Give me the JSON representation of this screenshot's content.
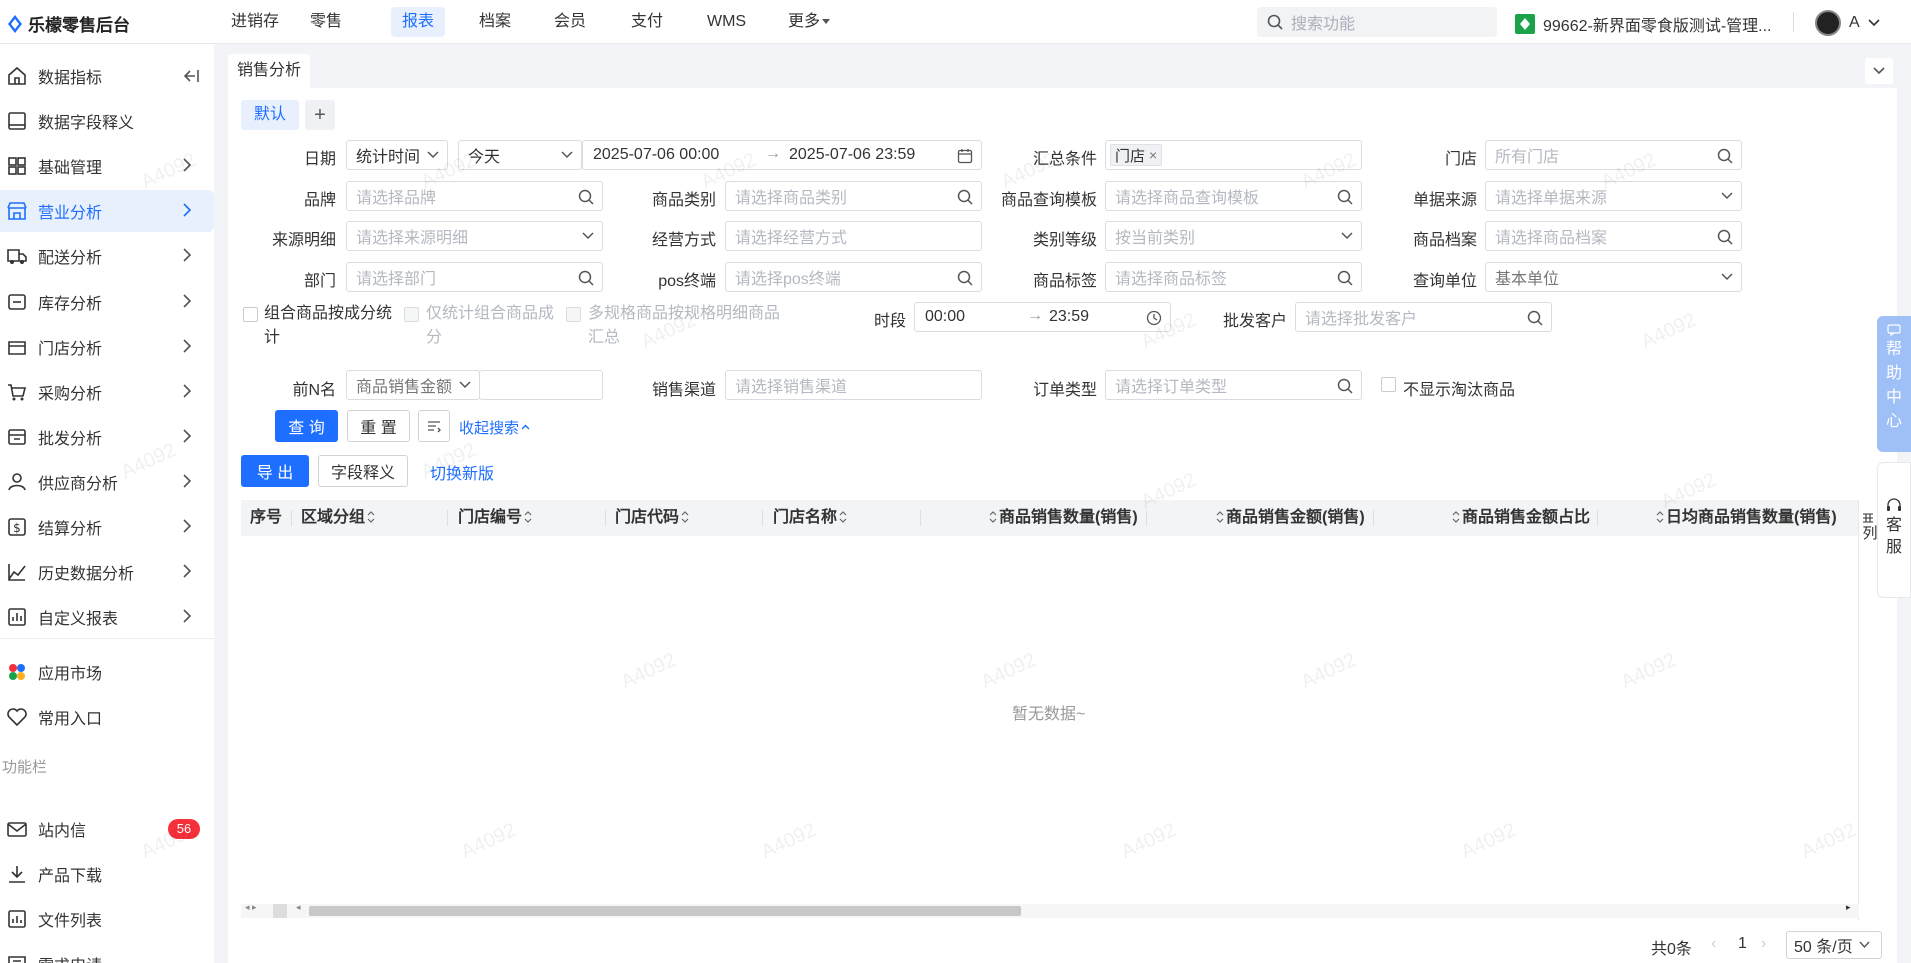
{
  "brand": {
    "name": "乐檬零售后台",
    "color": "#1e6fff"
  },
  "topnav": {
    "items": [
      "进销存",
      "零售",
      "报表",
      "档案",
      "会员",
      "支付",
      "WMS",
      "更多"
    ],
    "active_index": 2
  },
  "search": {
    "placeholder": "搜索功能"
  },
  "store": {
    "label": "99662-新界面零食版测试-管理..."
  },
  "user": {
    "name": "A"
  },
  "sidebar": {
    "collapse_icon": "collapse-icon",
    "items": [
      {
        "label": "数据指标",
        "icon": "home-icon"
      },
      {
        "label": "数据字段释义",
        "icon": "book-icon"
      },
      {
        "label": "基础管理",
        "icon": "grid-icon"
      },
      {
        "label": "营业分析",
        "icon": "store-icon"
      },
      {
        "label": "配送分析",
        "icon": "truck-icon"
      },
      {
        "label": "库存分析",
        "icon": "inventory-icon"
      },
      {
        "label": "门店分析",
        "icon": "shop-icon"
      },
      {
        "label": "采购分析",
        "icon": "cart-icon"
      },
      {
        "label": "批发分析",
        "icon": "wholesale-icon"
      },
      {
        "label": "供应商分析",
        "icon": "user-icon"
      },
      {
        "label": "结算分析",
        "icon": "dollar-icon"
      },
      {
        "label": "历史数据分析",
        "icon": "trend-icon"
      },
      {
        "label": "自定义报表",
        "icon": "report-icon"
      }
    ],
    "active_index": 3,
    "extra": [
      {
        "label": "应用市场",
        "icon": "apps-icon"
      },
      {
        "label": "常用入口",
        "icon": "heart-icon"
      }
    ],
    "section_label": "功能栏",
    "tools": [
      {
        "label": "站内信",
        "icon": "mail-icon",
        "badge": "56"
      },
      {
        "label": "产品下载",
        "icon": "download-icon"
      },
      {
        "label": "文件列表",
        "icon": "file-icon"
      },
      {
        "label": "需求申请",
        "icon": "request-icon"
      }
    ]
  },
  "page_tab": "销售分析",
  "presets": {
    "default": "默认",
    "add": "+"
  },
  "filters": {
    "date_label": "日期",
    "date_type": "统计时间",
    "date_range": "今天",
    "date_start": "2025-07-06 00:00",
    "date_end": "2025-07-06 23:59",
    "summary_label": "汇总条件",
    "summary_tag": "门店",
    "store_label": "门店",
    "store_ph": "所有门店",
    "brand_label": "品牌",
    "brand_ph": "请选择品牌",
    "category_label": "商品类别",
    "category_ph": "请选择商品类别",
    "template_label": "商品查询模板",
    "template_ph": "请选择商品查询模板",
    "source_label": "单据来源",
    "source_ph": "请选择单据来源",
    "srcdetail_label": "来源明细",
    "srcdetail_ph": "请选择来源明细",
    "mode_label": "经营方式",
    "mode_ph": "请选择经营方式",
    "level_label": "类别等级",
    "level_ph": "按当前类别",
    "archive_label": "商品档案",
    "archive_ph": "请选择商品档案",
    "dept_label": "部门",
    "dept_ph": "请选择部门",
    "pos_label": "pos终端",
    "pos_ph": "请选择pos终端",
    "tag_label": "商品标签",
    "tag_ph": "请选择商品标签",
    "unit_label": "查询单位",
    "unit_val": "基本单位",
    "combo_label": "组合商品按成分统计",
    "only_combo_label": "仅统计组合商品成分",
    "multi_label": "多规格商品按规格明细商品汇总",
    "period_label": "时段",
    "period_start": "00:00",
    "period_end": "23:59",
    "wholesale_label": "批发客户",
    "wholesale_ph": "请选择批发客户",
    "topn_label": "前N名",
    "topn_val": "商品销售金额",
    "channel_label": "销售渠道",
    "channel_ph": "请选择销售渠道",
    "ordertype_label": "订单类型",
    "ordertype_ph": "请选择订单类型",
    "hide_label": "不显示淘汰商品"
  },
  "buttons": {
    "query": "查 询",
    "reset": "重 置",
    "collapse": "收起搜索",
    "export": "导 出",
    "fields": "字段释义",
    "switch": "切换新版"
  },
  "table": {
    "columns": [
      "序号",
      "区域分组",
      "门店编号",
      "门店代码",
      "门店名称",
      "商品销售数量(销售)",
      "商品销售金额(销售)",
      "商品销售金额占比",
      "日均商品销售数量(销售)"
    ],
    "empty": "暂无数据~"
  },
  "pagination": {
    "total": "共0条",
    "page": "1",
    "size": "50 条/页"
  },
  "float": {
    "help": "帮助中心",
    "service": "客服",
    "col_settings": "列"
  },
  "watermark": "A4092"
}
